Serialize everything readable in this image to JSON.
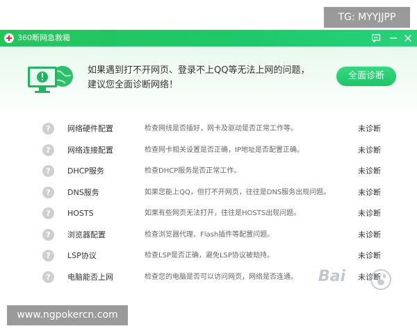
{
  "overlay": {
    "tg_label": "TG: MYYJJPP",
    "site_label": "www.ngpokercn.com",
    "baidu_label": "Bai"
  },
  "window": {
    "title": "360断网急救箱",
    "feedback_icon": "chat-icon",
    "minimize_icon": "minus-icon",
    "close_icon": "close-icon",
    "accent_color": "#1fc86a"
  },
  "hero": {
    "line1": "如果遇到打不开网页、登录不上QQ等无法上网的问题，",
    "line2": "建议您全面诊断网络！",
    "button_label": "全面诊断"
  },
  "items": [
    {
      "name": "网络硬件配置",
      "desc": "检查网线是否插好，网卡及驱动是否正常工作等。",
      "status": "未诊断"
    },
    {
      "name": "网络连接配置",
      "desc": "检查网卡相关设置是否正确，IP地址是否配置正确。",
      "status": "未诊断"
    },
    {
      "name": "DHCP服务",
      "desc": "检查DHCP服务是否正常工作。",
      "status": "未诊断"
    },
    {
      "name": "DNS服务",
      "desc": "如果您能上QQ，但打不开网页，往往是DNS服务出现问题。",
      "status": "未诊断"
    },
    {
      "name": "HOSTS",
      "desc": "如果有些网页无法打开，往往是HOSTS出现问题。",
      "status": "未诊断"
    },
    {
      "name": "浏览器配置",
      "desc": "检查浏览器代理、Flash插件等配置问题。",
      "status": "未诊断"
    },
    {
      "name": "LSP协议",
      "desc": "检查LSP是否正确，避免LSP协议被劫持。",
      "status": "未诊断"
    },
    {
      "name": "电脑能否上网",
      "desc": "检查您的电脑是否可以访问网页，网络是否连通。",
      "status": "未诊断"
    }
  ]
}
